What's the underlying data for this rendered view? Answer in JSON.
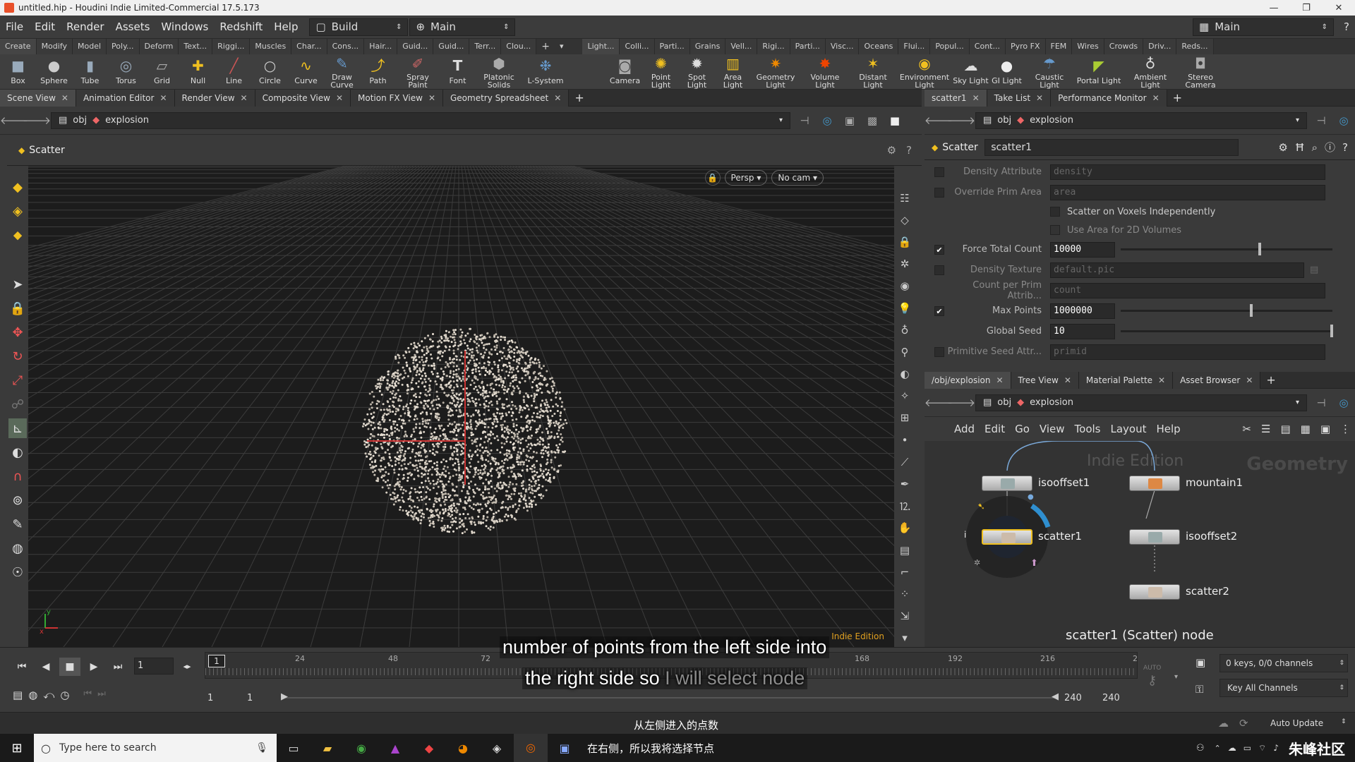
{
  "window": {
    "title": "untitled.hip - Houdini Indie Limited-Commercial 17.5.173"
  },
  "menubar": {
    "items": [
      "File",
      "Edit",
      "Render",
      "Assets",
      "Windows",
      "Redshift",
      "Help"
    ],
    "desktop_left": "Build",
    "desktop_right": "Main",
    "desktop_far": "Main"
  },
  "shelf": {
    "left_tabs": [
      "Create",
      "Modify",
      "Model",
      "Poly...",
      "Deform",
      "Text...",
      "Riggi...",
      "Muscles",
      "Char...",
      "Cons...",
      "Hair...",
      "Guid...",
      "Guid...",
      "Terr...",
      "Clou..."
    ],
    "right_tabs": [
      "Light...",
      "Colli...",
      "Parti...",
      "Grains",
      "Vell...",
      "Rigi...",
      "Parti...",
      "Visc...",
      "Oceans",
      "Flui...",
      "Popul...",
      "Cont...",
      "Pyro FX",
      "FEM",
      "Wires",
      "Crowds",
      "Driv...",
      "Reds..."
    ],
    "left_tools": [
      "Box",
      "Sphere",
      "Tube",
      "Torus",
      "Grid",
      "Null",
      "Line",
      "Circle",
      "Curve",
      "Draw Curve",
      "Path",
      "Spray Paint",
      "Font",
      "Platonic Solids",
      "L-System"
    ],
    "right_tools": [
      "Camera",
      "Point Light",
      "Spot Light",
      "Area Light",
      "Geometry Light",
      "Volume Light",
      "Distant Light",
      "Environment Light",
      "Sky Light",
      "GI Light",
      "Caustic Light",
      "Portal Light",
      "Ambient Light",
      "Stereo Camera"
    ]
  },
  "left_pane": {
    "tabs": [
      "Scene View",
      "Animation Editor",
      "Render View",
      "Composite View",
      "Motion FX View",
      "Geometry Spreadsheet"
    ],
    "path": {
      "root": "obj",
      "node": "explosion"
    },
    "header": "Scatter",
    "view_persp": "Persp",
    "view_cam": "No cam",
    "watermark": "Indie Edition"
  },
  "param_pane": {
    "tabs": [
      "scatter1",
      "Take List",
      "Performance Monitor"
    ],
    "path": {
      "root": "obj",
      "node": "explosion"
    },
    "node_type": "Scatter",
    "node_name": "scatter1",
    "params": [
      {
        "label": "Density Attribute",
        "value": "density",
        "checked": false,
        "enabled": false
      },
      {
        "label": "Override Prim Area",
        "value": "area",
        "checked": false,
        "enabled": false
      },
      {
        "label": "Scatter on Voxels Independently",
        "checked": false,
        "toggle": true
      },
      {
        "label": "Use Area for 2D Volumes",
        "checked": false,
        "toggle": true,
        "enabled": false
      },
      {
        "label": "Force Total Count",
        "value": "10000",
        "checked": true,
        "enabled": true,
        "slider": 0.65
      },
      {
        "label": "Density Texture",
        "value": "default.pic",
        "checked": false,
        "enabled": false
      },
      {
        "label": "Count per Prim Attrib...",
        "value": "count",
        "checked": false,
        "enabled": false
      },
      {
        "label": "Max Points",
        "value": "1000000",
        "checked": true,
        "enabled": true,
        "slider": 0.61
      },
      {
        "label": "Global Seed",
        "value": "10",
        "checked": false,
        "enabled": true,
        "slider": 0.99
      },
      {
        "label": "Primitive Seed Attr...",
        "value": "primid",
        "checked": false,
        "enabled": false
      }
    ]
  },
  "network_pane": {
    "tabs": [
      "/obj/explosion",
      "Tree View",
      "Material Palette",
      "Asset Browser"
    ],
    "path": {
      "root": "obj",
      "node": "explosion"
    },
    "menu": [
      "Add",
      "Edit",
      "Go",
      "View",
      "Tools",
      "Layout",
      "Help"
    ],
    "watermark_edition": "Indie Edition",
    "watermark_context": "Geometry",
    "nodes": [
      "isooffset1",
      "scatter1",
      "mountain1",
      "isooffset2",
      "scatter2"
    ],
    "info_text": "scatter1 (Scatter) node"
  },
  "timeline": {
    "current_frame": "1",
    "ticks": [
      "1",
      "24",
      "48",
      "72",
      "168",
      "192",
      "216",
      "2"
    ],
    "range_start": "1",
    "range_start2": "1",
    "range_end": "240",
    "range_end2": "240",
    "keys_info": "0 keys, 0/0 channels",
    "key_all": "Key All Channels",
    "auto_update": "Auto Update",
    "auto_key": "AUTO"
  },
  "subtitles": {
    "line1": "number of points from the left side into",
    "line2_a": "the right side so",
    "line2_b": "I will select node",
    "cn_line1": "从左侧进入的点数",
    "cn_line2": "在右侧，所以我将选择节点"
  },
  "taskbar": {
    "search_placeholder": "Type here to search",
    "brand": "朱峰社区"
  },
  "colors": {
    "accent": "#f0c020",
    "bg_dark": "#1c1c1c",
    "panel": "#3a3a3a"
  }
}
